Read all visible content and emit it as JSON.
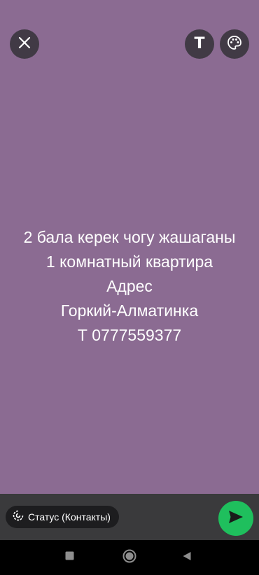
{
  "toolbar": {
    "close_icon": "close-icon",
    "text_icon": "text-icon",
    "text_glyph": "T",
    "palette_icon": "palette-icon"
  },
  "status": {
    "lines": [
      "2 бала керек чогу жашаганы",
      "1 комнатный квартира",
      "Адрес",
      "Горкий-Алматинка",
      "Т 0777559377"
    ],
    "background_color": "#8b6b92",
    "text_color": "#ffffff"
  },
  "composer": {
    "audience_icon": "status-privacy-icon",
    "audience_label": "Статус (Контакты)",
    "send_icon": "send-icon",
    "send_color": "#1fbf5d"
  },
  "system_nav": {
    "recents_icon": "square-icon",
    "home_icon": "circle-icon",
    "back_icon": "triangle-back-icon"
  }
}
